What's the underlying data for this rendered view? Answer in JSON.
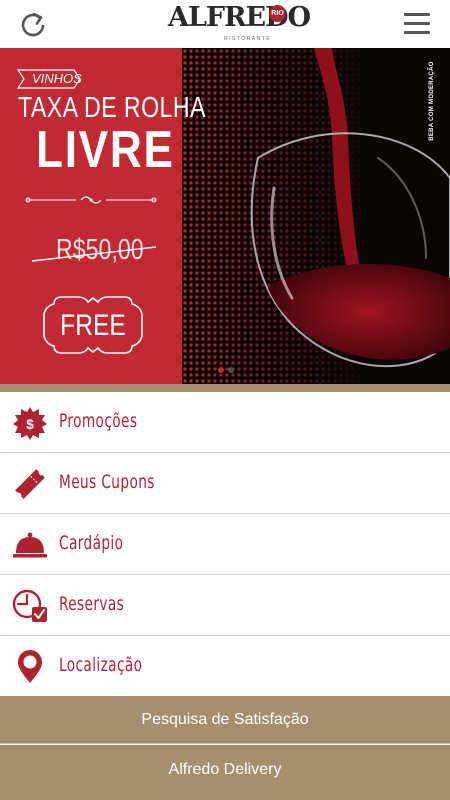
{
  "header": {
    "logo_text": "ALFREDO",
    "logo_badge": "RIO",
    "logo_subtitle": "RISTORANTE",
    "refresh_icon": "refresh-icon",
    "menu_icon": "hamburger-menu-icon"
  },
  "banner": {
    "tag": "VINHOS",
    "headline": "TAXA DE ROLHA",
    "headline_big": "LIVRE",
    "old_price": "R$50,00",
    "free_label": "FREE",
    "vertical_note": "BEBA COM MODERAÇÃO",
    "colors": {
      "red": "#c12a33",
      "dark": "#0b0606"
    }
  },
  "menu": {
    "items": [
      {
        "label": "Promoções",
        "icon": "promo-badge-icon"
      },
      {
        "label": "Meus Cupons",
        "icon": "ticket-icon"
      },
      {
        "label": "Cardápio",
        "icon": "food-cloche-icon"
      },
      {
        "label": "Reservas",
        "icon": "clock-check-icon"
      },
      {
        "label": "Localização",
        "icon": "location-pin-icon"
      }
    ]
  },
  "buttons": {
    "survey": "Pesquisa de Satisfação",
    "delivery": "Alfredo Delivery"
  },
  "colors": {
    "accent": "#b0222f",
    "gold": "#a58f6c",
    "divider": "#d9d6d2"
  }
}
